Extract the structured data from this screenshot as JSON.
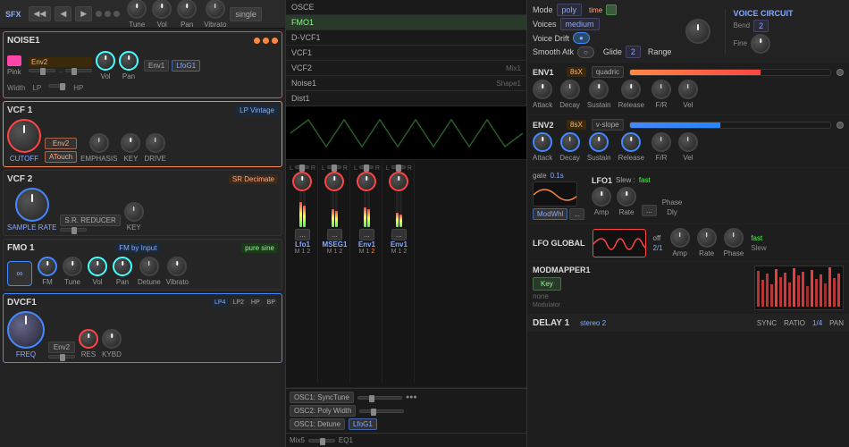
{
  "left": {
    "topbar": {
      "sfx_label": "SFX",
      "buttons": [
        "◀◀",
        "◀",
        "▶"
      ],
      "knob_labels": [
        "Tune",
        "Vol",
        "Pan"
      ],
      "vibrato_label": "Vibrato",
      "single_label": "single",
      "dots": [
        "●",
        "●",
        "●"
      ]
    },
    "noise1": {
      "title": "NOISE1",
      "color_label": "Pink",
      "env_label": "Env2",
      "knobs": [
        {
          "label": "Vol"
        },
        {
          "label": "Pan"
        }
      ],
      "env1_label": "Env1",
      "lfo_label": "LfoG1",
      "width_label": "Width",
      "lp_label": "LP",
      "hp_label": "HP"
    },
    "vcf1": {
      "title": "VCF 1",
      "tag": "LP Vintage",
      "cutoff_label": "CUTOFF",
      "env_label": "Env2",
      "touch_label": "ATouch",
      "emphasis_label": "EMPHASIS",
      "key_label": "KEY",
      "drive_label": "DRIVE"
    },
    "vcf2": {
      "title": "VCF 2",
      "tag": "SR Decimate",
      "sample_rate_label": "SAMPLE RATE",
      "reducer_label": "S.R. REDUCER",
      "key_label": "KEY"
    },
    "fmo1": {
      "title": "FMO 1",
      "tag1": "FM by Input",
      "tag2": "pure sine",
      "knobs": [
        {
          "label": "FM"
        },
        {
          "label": "Tune"
        },
        {
          "label": "Vol"
        },
        {
          "label": "Pan"
        },
        {
          "label": "Detune"
        }
      ],
      "vibrato_label": "Vibrato"
    },
    "dvcf1": {
      "title": "DVCF1",
      "env_label": "Env2",
      "freq_label": "FREQ",
      "res_label": "RES",
      "kybd_label": "KYBD",
      "tags": [
        "LP4",
        "LP2",
        "HP",
        "BP"
      ]
    }
  },
  "middle": {
    "osc_list": [
      {
        "id": "OSCE",
        "label": "OSCE"
      },
      {
        "id": "FMO1",
        "label": "FMO1",
        "active": true
      },
      {
        "id": "D-VCF1",
        "label": "D-VCF1"
      },
      {
        "id": "VCF1",
        "label": "VCF1"
      },
      {
        "id": "VCF2",
        "label": "VCF2",
        "sub": "Mix1"
      },
      {
        "id": "Noise1",
        "label": "Noise1",
        "sub": "Shape1"
      },
      {
        "id": "Dist1",
        "label": "Dist1"
      }
    ],
    "channels": [
      {
        "id": "1",
        "label": "Lfo1"
      },
      {
        "id": "2",
        "label": "MSEG1"
      },
      {
        "id": "3",
        "label": "Env1"
      },
      {
        "id": "4",
        "label": "Env1"
      }
    ],
    "bottom": {
      "buttons": [
        "OSC1: SyncTune",
        "OSC2: Poly Width",
        "OSC1: Detune"
      ],
      "values": [
        "...",
        "...",
        "LfoG1"
      ]
    }
  },
  "right": {
    "voice": {
      "mode_label": "Mode",
      "mode_value": "poly",
      "voices_label": "Voices",
      "voices_value": "medium",
      "drift_label": "Voice Drift",
      "smooth_label": "Smooth Atk",
      "glide_label": "Glide",
      "glide_value": "2",
      "range_label": "Range",
      "title": "VOICE CIRCUIT",
      "bend_label": "Bend",
      "bend_value": "2",
      "fine_label": "Fine",
      "time_label": "time"
    },
    "env1": {
      "title": "ENV1",
      "multiplier": "8sX",
      "mode": "quadric",
      "knobs": [
        {
          "label": "Attack"
        },
        {
          "label": "Decay"
        },
        {
          "label": "Sustain"
        },
        {
          "label": "Release"
        },
        {
          "label": "F/R"
        },
        {
          "label": "Vel"
        }
      ]
    },
    "env2": {
      "title": "ENV2",
      "multiplier": "8sX",
      "mode": "v-slope",
      "knobs": [
        {
          "label": "Attack"
        },
        {
          "label": "Decay"
        },
        {
          "label": "Sustain"
        },
        {
          "label": "Release"
        },
        {
          "label": "F/R"
        },
        {
          "label": "Vel"
        }
      ]
    },
    "lfo1": {
      "title": "LFO1",
      "slew_label": "Slew :",
      "slew_value": "fast",
      "gate_label": "gate",
      "gate_value": "0.1s",
      "mod_label": "ModWhl",
      "knobs": [
        {
          "label": "Amp"
        },
        {
          "label": "Rate"
        }
      ],
      "right_labels": [
        "Phase",
        "Dly"
      ]
    },
    "lfo_global": {
      "title": "LFO GLOBAL",
      "fast_label": "fast",
      "slew_label": "Slew",
      "off_label": "off",
      "ratio_label": "2/1",
      "knobs": [
        {
          "label": "Amp"
        },
        {
          "label": "Rate"
        },
        {
          "label": "Phase"
        }
      ]
    },
    "modmapper": {
      "title": "MODMAPPER1",
      "key_label": "Key",
      "none_label": "none",
      "modulator_label": "Modulator"
    },
    "delay": {
      "title": "DELAY 1",
      "stereo_label": "stereo 2",
      "sync_label": "SYNC",
      "ratio_label": "RATIO",
      "pan_label": "PAN",
      "ratio_value": "1/4"
    }
  }
}
